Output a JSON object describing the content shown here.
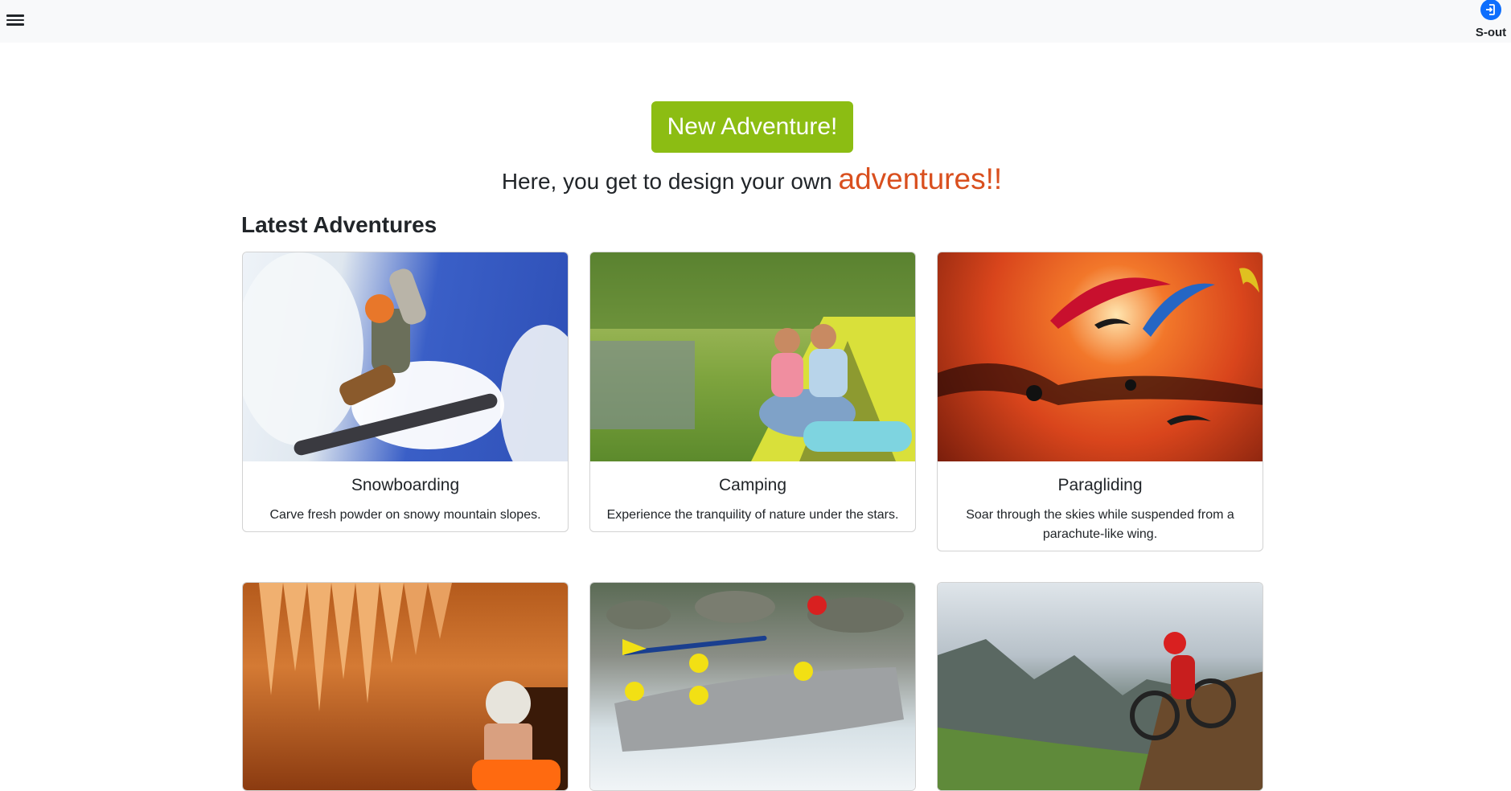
{
  "navbar": {
    "menu_icon": "hamburger-menu-icon",
    "signout_icon": "sign-out-icon",
    "signout_label": "S-out"
  },
  "hero": {
    "button_label": "New Adventure!",
    "tagline_prefix": "Here, you get to design your own ",
    "tagline_accent": "adventures!!"
  },
  "colors": {
    "accent_green": "#8cbd13",
    "accent_orange": "#d94f1e",
    "brand_blue": "#0d6efd"
  },
  "section": {
    "title": "Latest Adventures"
  },
  "cards": [
    {
      "title": "Snowboarding",
      "text": "Carve fresh powder on snowy mountain slopes."
    },
    {
      "title": "Camping",
      "text": "Experience the tranquility of nature under the stars."
    },
    {
      "title": "Paragliding",
      "text": "Soar through the skies while suspended from a parachute-like wing."
    },
    {
      "title": "",
      "text": ""
    },
    {
      "title": "",
      "text": ""
    },
    {
      "title": "",
      "text": ""
    }
  ]
}
